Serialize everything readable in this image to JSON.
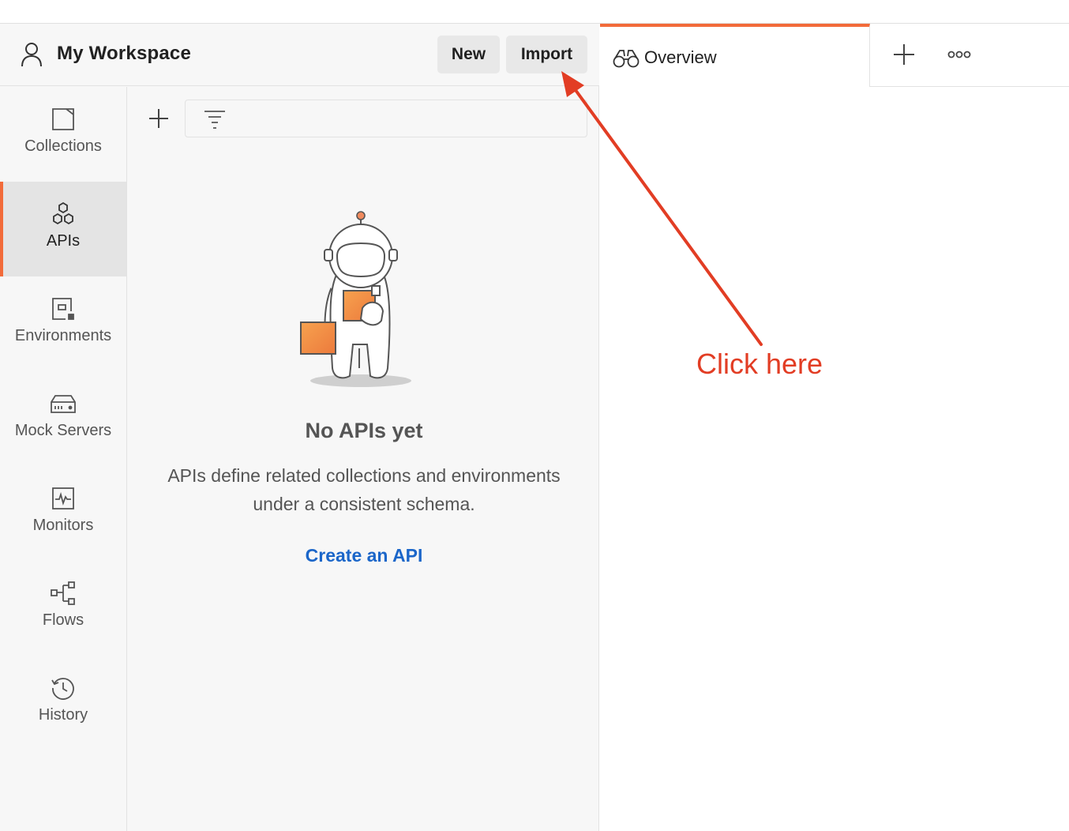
{
  "workspace": {
    "title": "My Workspace",
    "new_label": "New",
    "import_label": "Import"
  },
  "sidebar": {
    "items": [
      {
        "label": "Collections",
        "icon": "collections-icon"
      },
      {
        "label": "APIs",
        "icon": "apis-icon",
        "active": true
      },
      {
        "label": "Environments",
        "icon": "environments-icon"
      },
      {
        "label": "Mock Servers",
        "icon": "mock-servers-icon"
      },
      {
        "label": "Monitors",
        "icon": "monitors-icon"
      },
      {
        "label": "Flows",
        "icon": "flows-icon"
      },
      {
        "label": "History",
        "icon": "history-icon"
      }
    ]
  },
  "empty_state": {
    "title": "No APIs yet",
    "description": "APIs define related collections and environments under a consistent schema.",
    "action_label": "Create an API"
  },
  "tabs": {
    "overview_label": "Overview"
  },
  "annotation": {
    "text": "Click here"
  },
  "colors": {
    "accent": "#f26b3a",
    "link": "#1b66c9",
    "annotation": "#e23d24"
  }
}
